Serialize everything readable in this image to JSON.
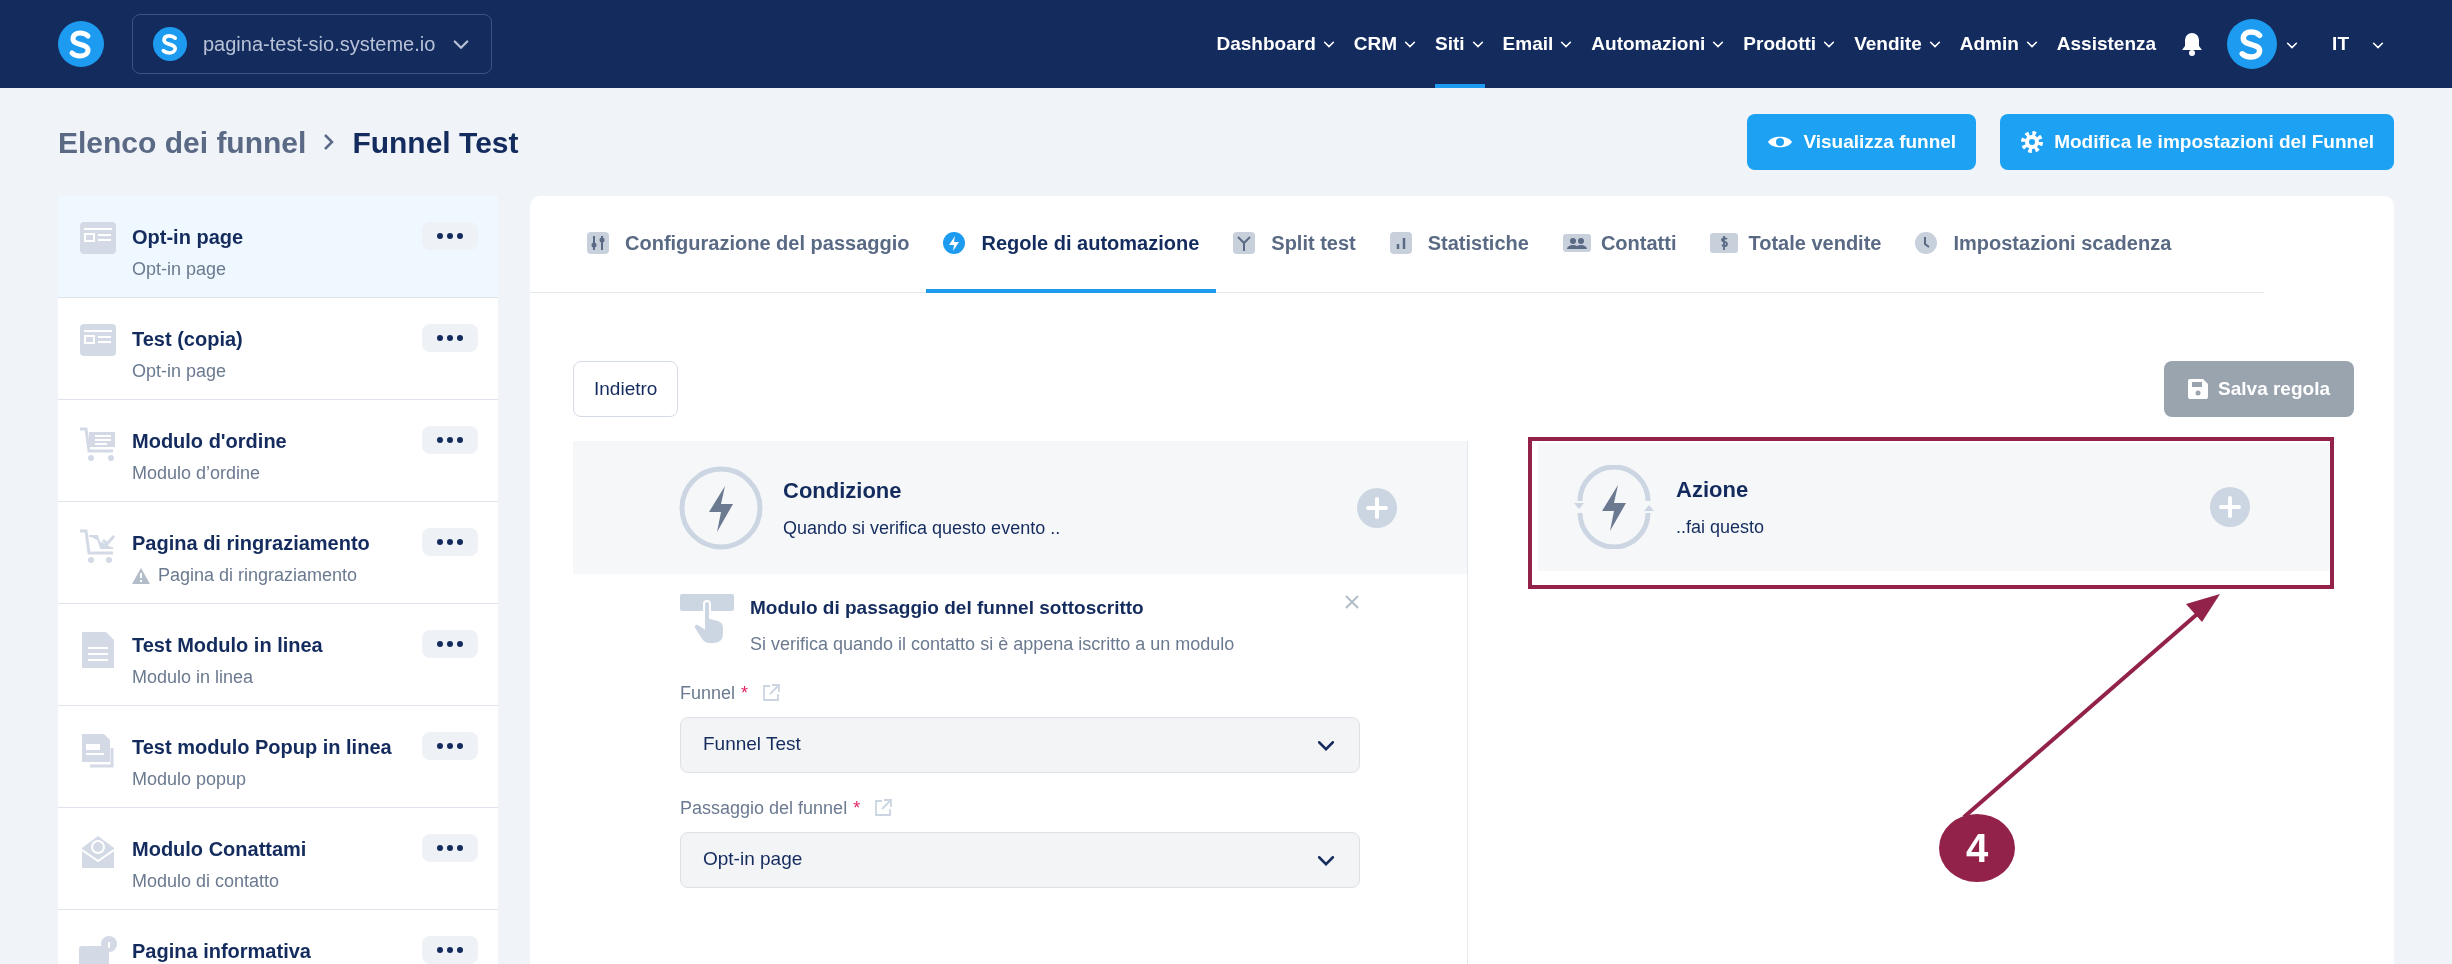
{
  "topbar": {
    "site": "pagina-test-sio.systeme.io",
    "menu": [
      {
        "label": "Dashboard",
        "selected": false,
        "dropdown": true
      },
      {
        "label": "CRM",
        "selected": false,
        "dropdown": true
      },
      {
        "label": "Siti",
        "selected": true,
        "dropdown": true
      },
      {
        "label": "Email",
        "selected": false,
        "dropdown": true
      },
      {
        "label": "Automazioni",
        "selected": false,
        "dropdown": true
      },
      {
        "label": "Prodotti",
        "selected": false,
        "dropdown": true
      },
      {
        "label": "Vendite",
        "selected": false,
        "dropdown": true
      },
      {
        "label": "Admin",
        "selected": false,
        "dropdown": true
      },
      {
        "label": "Assistenza",
        "selected": false,
        "dropdown": false
      }
    ],
    "language": "IT"
  },
  "breadcrumb": [
    "Elenco dei funnel",
    "Funnel Test"
  ],
  "header_buttons": [
    {
      "kind": "eye",
      "label": "Visualizza funnel"
    },
    {
      "kind": "gear",
      "label": "Modifica le impostazioni del Funnel"
    }
  ],
  "steps": [
    {
      "kind": "optin",
      "title": "Opt-in page",
      "subtitle": "Opt-in page",
      "selected": true,
      "warning": false
    },
    {
      "kind": "optin",
      "title": "Test (copia)",
      "subtitle": "Opt-in page",
      "selected": false,
      "warning": false
    },
    {
      "kind": "cart",
      "title": "Modulo d'ordine",
      "subtitle": "Modulo d’ordine",
      "selected": false,
      "warning": false
    },
    {
      "kind": "cartcheck",
      "title": "Pagina di ringraziamento",
      "subtitle": "Pagina di ringraziamento",
      "selected": false,
      "warning": true
    },
    {
      "kind": "doc",
      "title": "Test Modulo in linea",
      "subtitle": "Modulo in linea",
      "selected": false,
      "warning": false
    },
    {
      "kind": "popup",
      "title": "Test modulo Popup in linea",
      "subtitle": "Modulo popup",
      "selected": false,
      "warning": false
    },
    {
      "kind": "mail",
      "title": "Modulo Conattami",
      "subtitle": "Modulo di contatto",
      "selected": false,
      "warning": false
    },
    {
      "kind": "info",
      "title": "Pagina informativa",
      "selected": false
    }
  ],
  "tabs": [
    {
      "kind": "sliders",
      "label": "Configurazione del passaggio",
      "selected": false
    },
    {
      "kind": "bolt",
      "label": "Regole di automazione",
      "selected": true
    },
    {
      "kind": "split",
      "label": "Split test",
      "selected": false
    },
    {
      "kind": "chart",
      "label": "Statistiche",
      "selected": false
    },
    {
      "kind": "people",
      "label": "Contatti",
      "selected": false
    },
    {
      "kind": "dollar",
      "label": "Totale vendite",
      "selected": false
    },
    {
      "kind": "clock",
      "label": "Impostazioni scadenza",
      "selected": false
    }
  ],
  "back_button": "Indietro",
  "save_button": {
    "label": "Salva regola",
    "disabled": true
  },
  "condition": {
    "title": "Condizione",
    "subtitle": "Quando si verifica questo evento .."
  },
  "trigger": {
    "title": "Modulo di passaggio del funnel sottoscritto",
    "description": "Si verifica quando il contatto si è appena iscritto a un modulo",
    "fields": [
      {
        "label": "Funnel",
        "required_mark": "*",
        "value": "Funnel Test"
      },
      {
        "label": "Passaggio del funnel",
        "required_mark": "*",
        "value": "Opt-in page"
      }
    ]
  },
  "action": {
    "title": "Azione",
    "subtitle": "..fai questo",
    "highlighted": true
  },
  "callout": {
    "label": "4"
  }
}
